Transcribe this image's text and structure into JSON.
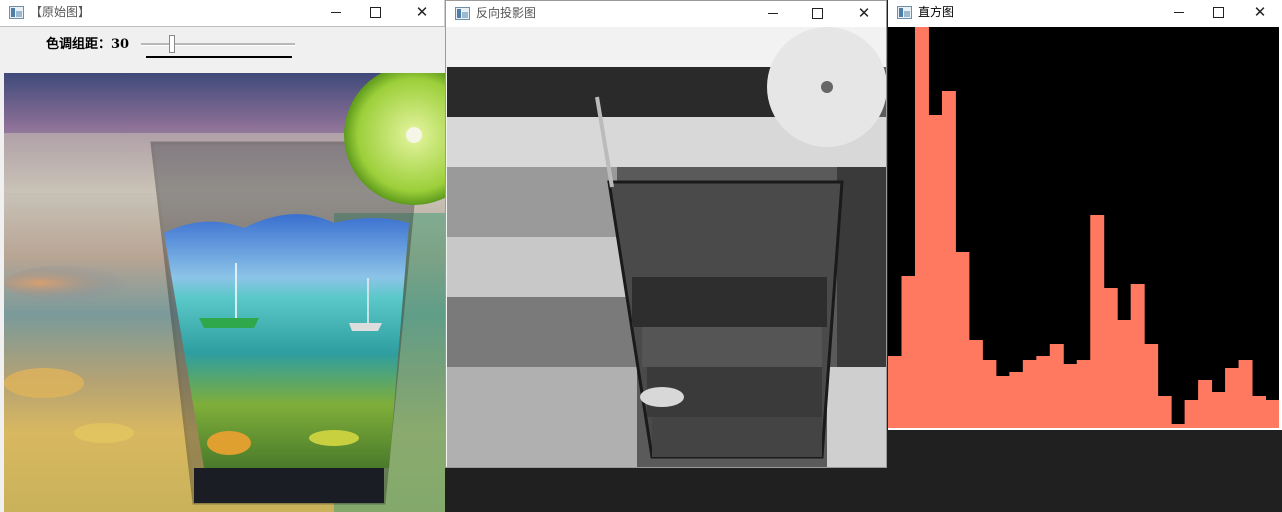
{
  "windows": {
    "original": {
      "title": "【原始图】",
      "trackbar": {
        "label": "色调组距：30",
        "value": 30
      }
    },
    "back_projection": {
      "title": "反向投影图"
    },
    "histogram": {
      "title": "直方图",
      "bin_color": "#ff7860",
      "bins": [
        0.18,
        0.38,
        1.0,
        0.78,
        0.84,
        0.44,
        0.22,
        0.17,
        0.13,
        0.14,
        0.17,
        0.18,
        0.21,
        0.16,
        0.17,
        0.53,
        0.35,
        0.27,
        0.36,
        0.21,
        0.08,
        0.01,
        0.07,
        0.12,
        0.09,
        0.15,
        0.17,
        0.08,
        0.07
      ]
    }
  },
  "controls": {
    "minimize": "minimize",
    "maximize": "maximize",
    "close": "✕"
  }
}
